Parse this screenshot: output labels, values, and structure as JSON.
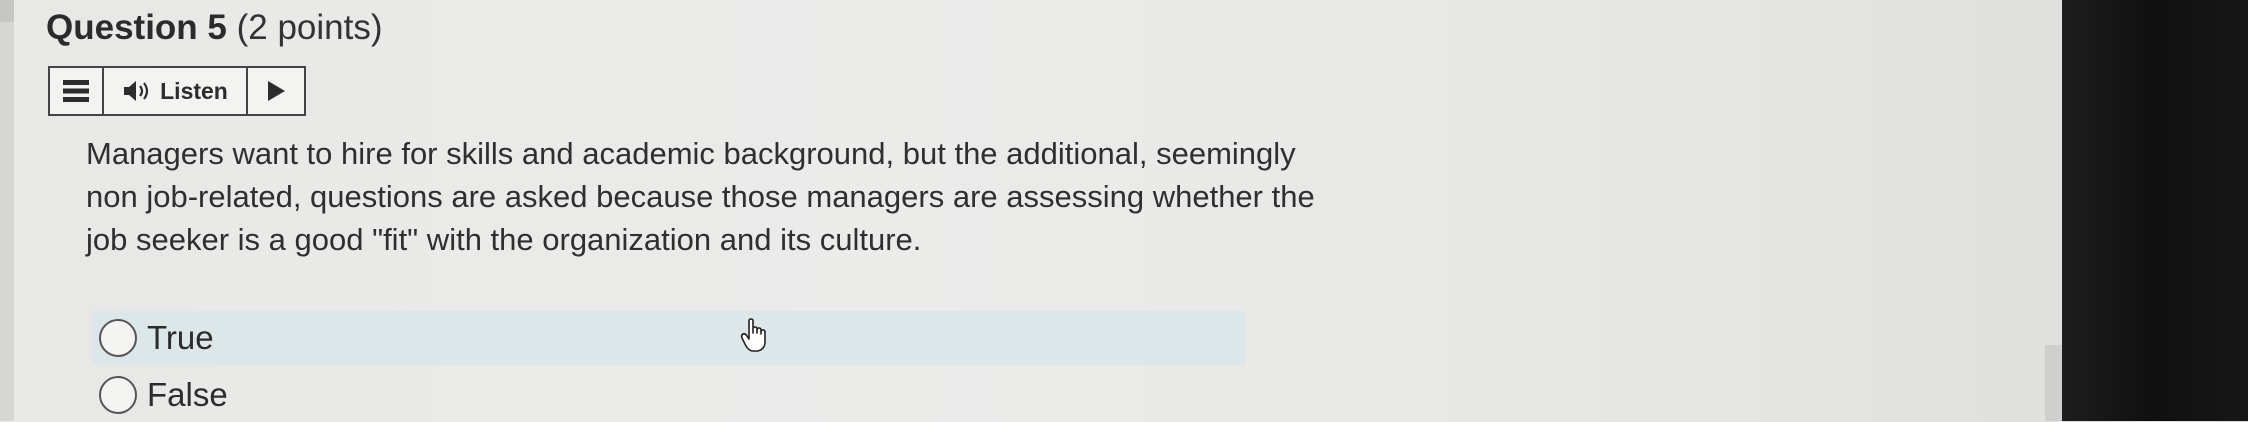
{
  "question": {
    "number_label": "Question 5",
    "points_label": "(2 points)",
    "text": "Managers want to hire for skills and academic background, but the additional, seemingly non job-related, questions are asked because those managers are assessing whether the job seeker is a good \"fit\" with the organization and its culture."
  },
  "listen_toolbar": {
    "menu_icon": "menu-icon",
    "speaker_icon": "speaker-icon",
    "listen_label": "Listen",
    "play_icon": "play-icon"
  },
  "options": [
    {
      "label": "True",
      "selected": false
    },
    {
      "label": "False",
      "selected": false
    }
  ],
  "colors": {
    "hover_highlight": "#dde6e9",
    "text": "#2f2f2f",
    "page_background": "#e8e8e6",
    "monitor_bezel": "#111111"
  }
}
